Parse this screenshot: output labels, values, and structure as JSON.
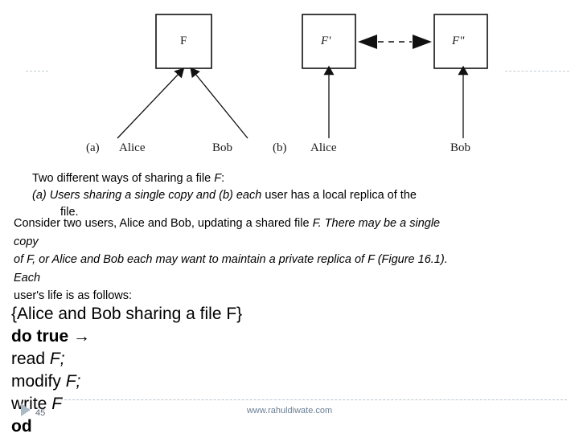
{
  "figure": {
    "name": "file-sharing-diagram",
    "part_a": {
      "label": "(a)",
      "box_letter": "F",
      "actors": [
        "Alice",
        "Bob"
      ]
    },
    "part_b": {
      "label": "(b)",
      "box_letters": [
        "F'",
        "F\""
      ],
      "actors": [
        "Alice",
        "Bob"
      ]
    }
  },
  "caption": {
    "line1_pre": "Two different ways of sharing a file ",
    "line1_var": "F",
    "line1_post": ":",
    "line2_italic": "(a) Users sharing a single copy and (b) each",
    "line2_plain": " user has a local replica of the",
    "line3": "file."
  },
  "body": {
    "line1_plain": "Consider two users, Alice and Bob, updating a shared file ",
    "line1_var": "F.",
    "line1_italic": " There may be a single",
    "line2": "copy",
    "line3": "of F, or Alice and Bob each may want to maintain a private replica of F (Figure 16.1).",
    "line4": "Each",
    "line5": "user's life is as follows:"
  },
  "code": {
    "line1": "{Alice and Bob sharing a file F}",
    "line2_kw": "do true",
    "line2_arrow": " →",
    "line3_op": "read ",
    "line3_var": "F;",
    "line4_op": "modify ",
    "line4_var": "F;",
    "line5_op": "write ",
    "line5_var": "F",
    "line6_kw": "od"
  },
  "footer": {
    "website": "www.rahuldiwate.com",
    "slide_number": "45"
  },
  "colors": {
    "ink": "#000000",
    "figure_ink": "#1a1a1a",
    "footer_text": "#6b7f92",
    "footer_rule": "#b9c4cf",
    "marker": "#aab9c6"
  }
}
